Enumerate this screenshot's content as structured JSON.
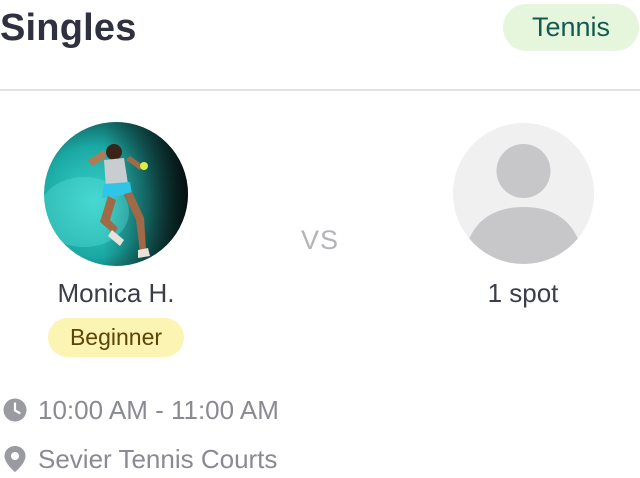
{
  "header": {
    "title": "Singles",
    "sport_badge": "Tennis"
  },
  "match": {
    "player": {
      "name": "Monica H.",
      "level": "Beginner",
      "avatar": "player-photo"
    },
    "versus_label": "VS",
    "open_slot": {
      "label": "1 spot",
      "avatar": "placeholder-person-icon"
    }
  },
  "details": {
    "time": {
      "icon": "clock-icon",
      "text": "10:00 AM - 11:00 AM"
    },
    "location": {
      "icon": "map-pin-icon",
      "text": "Sevier Tennis Courts"
    }
  },
  "colors": {
    "title": "#2f3140",
    "sport_badge_bg": "#e5f6dc",
    "sport_badge_text": "#125a52",
    "level_badge_bg": "#fcf4b3",
    "level_badge_text": "#5a4505",
    "muted_text": "#8a8b92",
    "divider": "#e2e2e5"
  }
}
